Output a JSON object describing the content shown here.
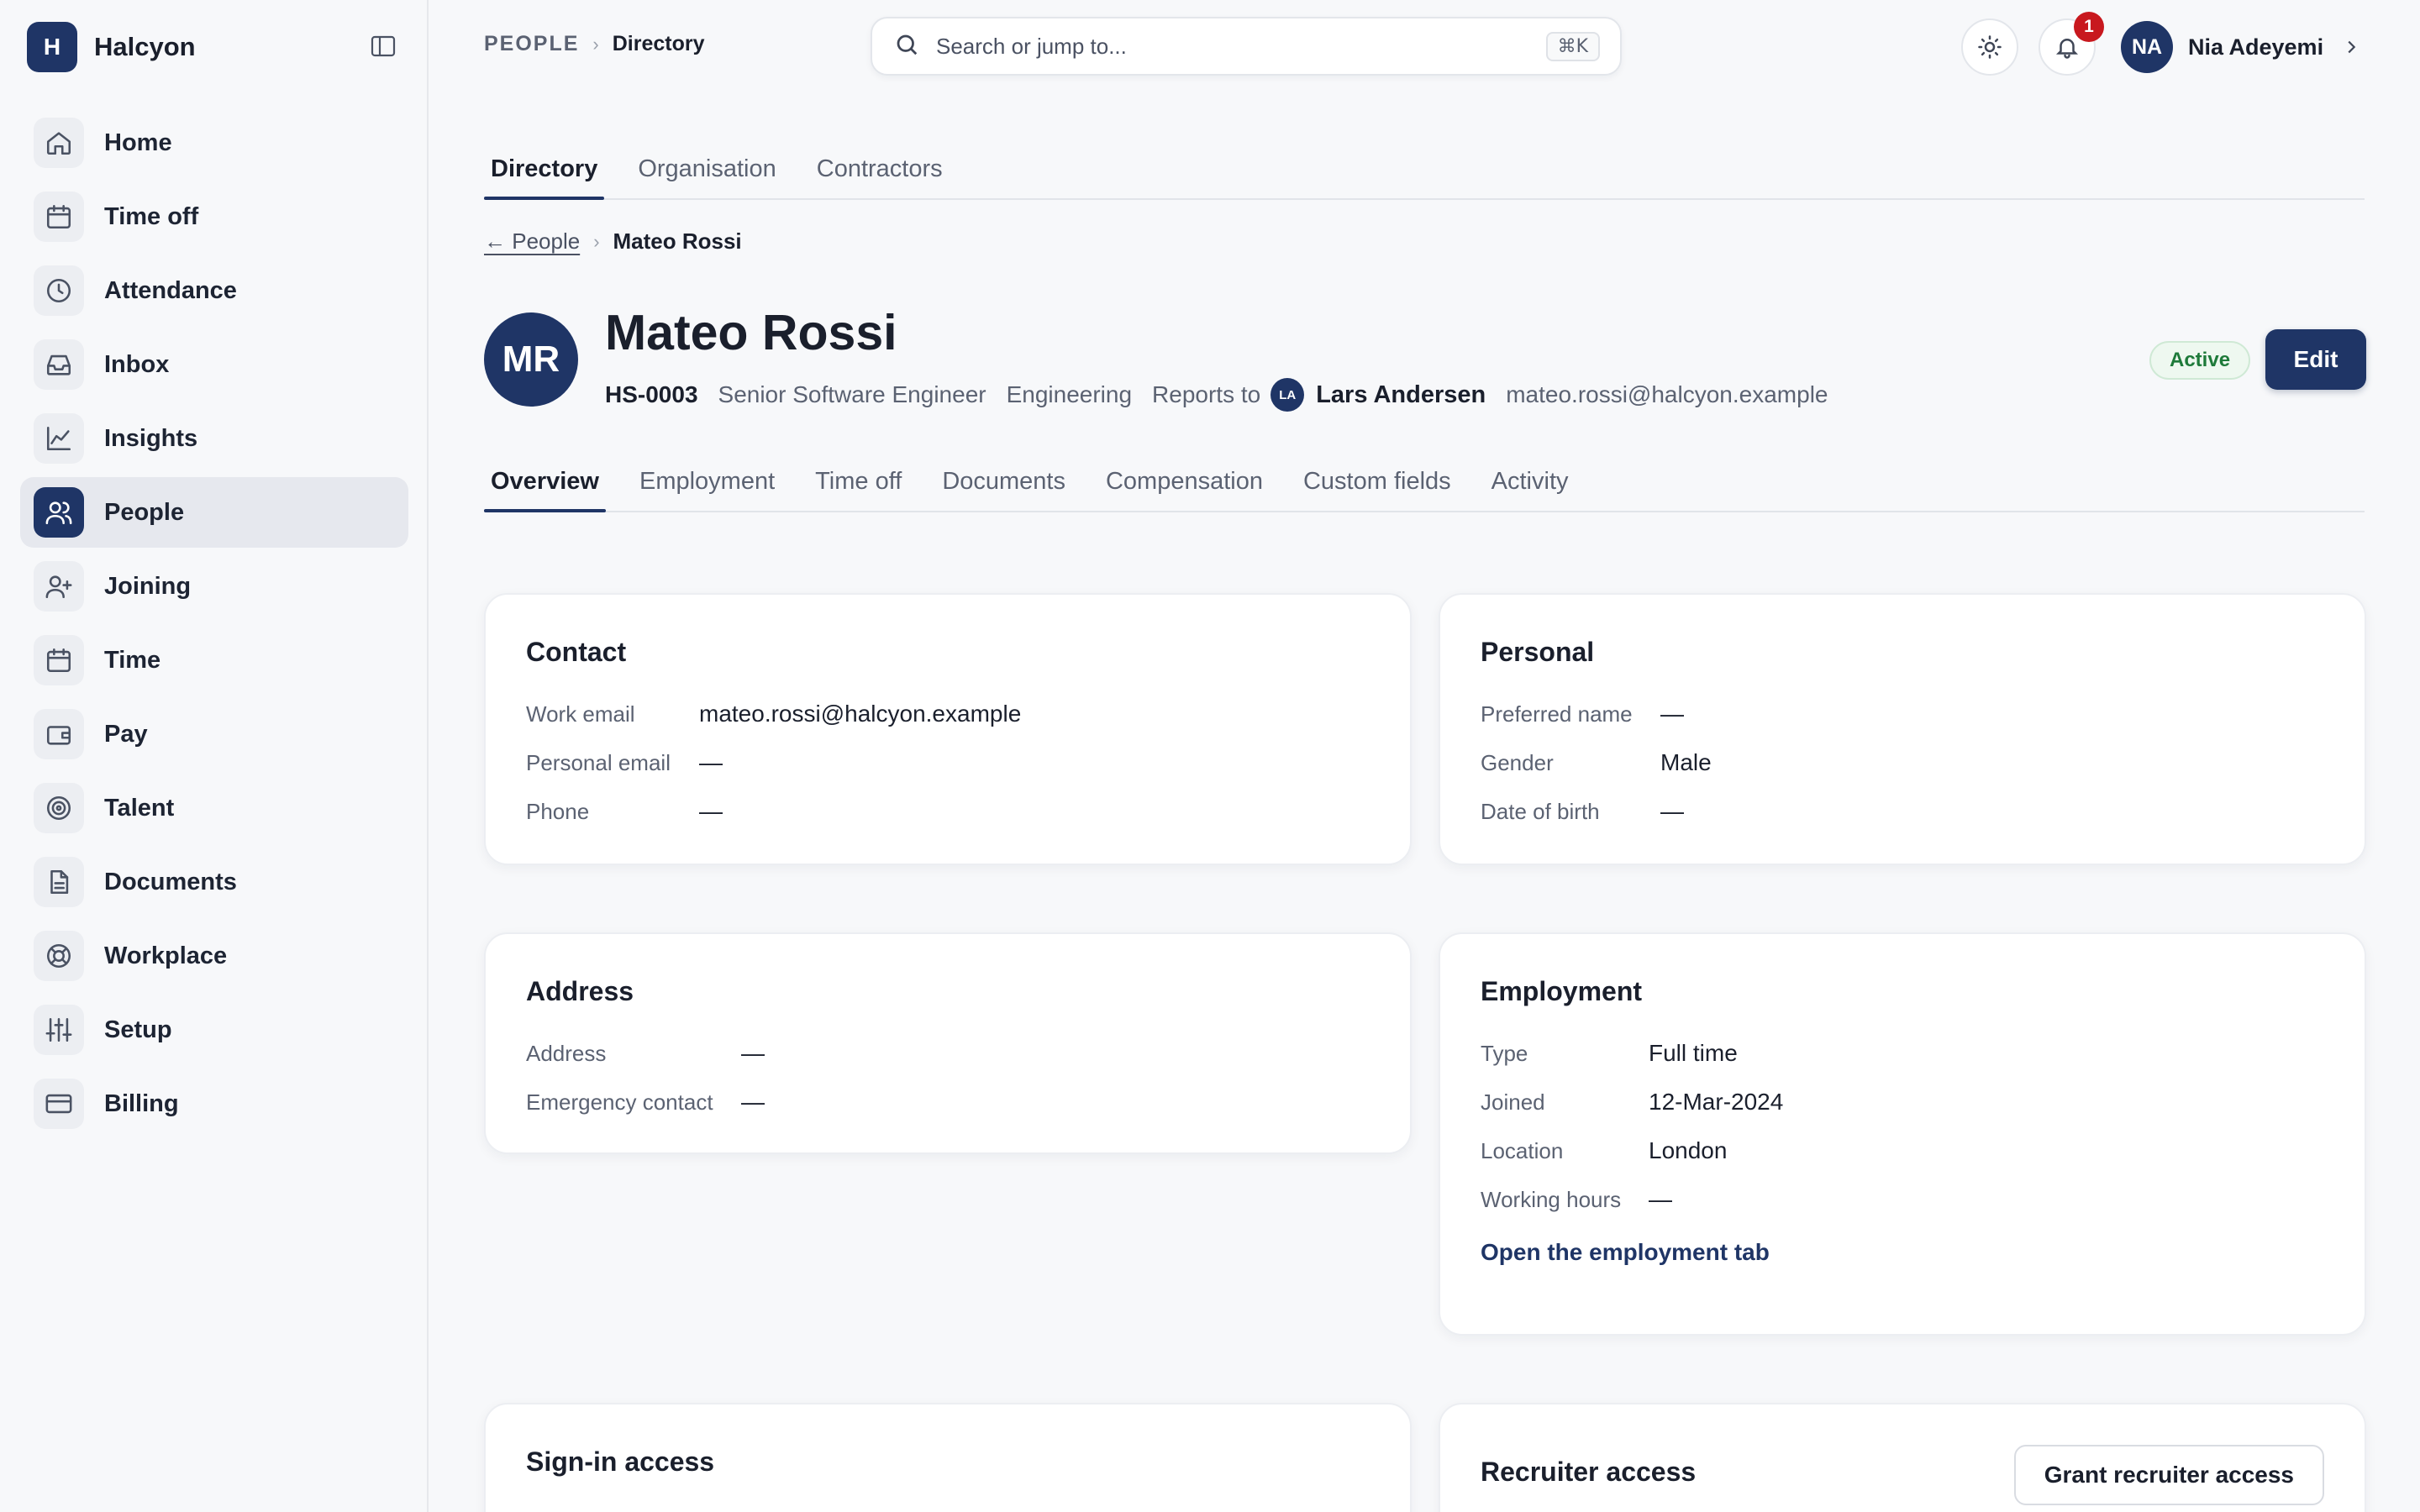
{
  "app": {
    "brand_initial": "H",
    "brand_name": "Halcyon"
  },
  "sidebar": {
    "items": [
      {
        "label": "Home",
        "icon": "home-icon"
      },
      {
        "label": "Time off",
        "icon": "calendar-icon"
      },
      {
        "label": "Attendance",
        "icon": "clock-icon"
      },
      {
        "label": "Inbox",
        "icon": "inbox-icon"
      },
      {
        "label": "Insights",
        "icon": "chart-icon"
      },
      {
        "label": "People",
        "icon": "people-icon",
        "active": true
      },
      {
        "label": "Joining",
        "icon": "user-plus-icon"
      },
      {
        "label": "Time",
        "icon": "calendar-icon"
      },
      {
        "label": "Pay",
        "icon": "wallet-icon"
      },
      {
        "label": "Talent",
        "icon": "target-icon"
      },
      {
        "label": "Documents",
        "icon": "document-icon"
      },
      {
        "label": "Workplace",
        "icon": "lifebuoy-icon"
      },
      {
        "label": "Setup",
        "icon": "sliders-icon"
      },
      {
        "label": "Billing",
        "icon": "credit-card-icon"
      }
    ]
  },
  "header": {
    "section": "PEOPLE",
    "page": "Directory",
    "search_placeholder": "Search or jump to...",
    "search_shortcut": "⌘K",
    "notifications_count": "1",
    "user_initials": "NA",
    "user_name": "Nia Adeyemi"
  },
  "top_tabs": [
    "Directory",
    "Organisation",
    "Contractors"
  ],
  "profile": {
    "back_label": "← People",
    "current": "Mateo Rossi",
    "initials": "MR",
    "name": "Mateo Rossi",
    "employee_id": "HS-0003",
    "title": "Senior Software Engineer",
    "department": "Engineering",
    "reports_to_label": "Reports to",
    "manager_initials": "LA",
    "manager_name": "Lars Andersen",
    "email": "mateo.rossi@halcyon.example",
    "status": "Active",
    "edit_label": "Edit"
  },
  "sub_tabs": [
    "Overview",
    "Employment",
    "Time off",
    "Documents",
    "Compensation",
    "Custom fields",
    "Activity"
  ],
  "cards": {
    "contact": {
      "title": "Contact",
      "rows": [
        {
          "label": "Work email",
          "value": "mateo.rossi@halcyon.example"
        },
        {
          "label": "Personal email",
          "value": "—"
        },
        {
          "label": "Phone",
          "value": "—"
        }
      ]
    },
    "personal": {
      "title": "Personal",
      "rows": [
        {
          "label": "Preferred name",
          "value": "—"
        },
        {
          "label": "Gender",
          "value": "Male"
        },
        {
          "label": "Date of birth",
          "value": "—"
        }
      ]
    },
    "address": {
      "title": "Address",
      "rows": [
        {
          "label": "Address",
          "value": "—"
        },
        {
          "label": "Emergency contact",
          "value": "—"
        }
      ]
    },
    "employment": {
      "title": "Employment",
      "rows": [
        {
          "label": "Type",
          "value": "Full time"
        },
        {
          "label": "Joined",
          "value": "12-Mar-2024"
        },
        {
          "label": "Location",
          "value": "London"
        },
        {
          "label": "Working hours",
          "value": "—"
        }
      ],
      "link": "Open the employment tab"
    },
    "signin": {
      "title": "Sign-in access"
    },
    "recruiter": {
      "title": "Recruiter access",
      "button": "Grant recruiter access"
    }
  },
  "colors": {
    "brand": "#1f3566",
    "badge_red": "#c8181e",
    "status_green": "#1e7a3a"
  }
}
